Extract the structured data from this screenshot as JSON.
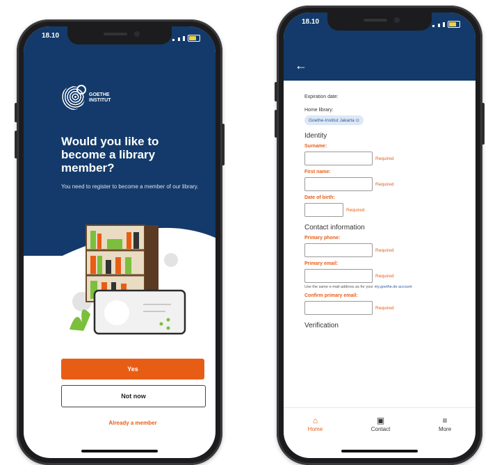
{
  "phone_left": {
    "time": "18.10",
    "logo_line1": "GOETHE",
    "logo_line2": "INSTITUT",
    "title": "Would you like to become a library member?",
    "subtitle": "You need to register to become a member of our library.",
    "yes_label": "Yes",
    "no_label": "Not now",
    "member_link": "Already a member"
  },
  "phone_right": {
    "time": "18.10",
    "form": {
      "expiration_label": "Expiration date:",
      "home_library_label": "Home library:",
      "home_library_value": "Goethe-Institut Jakarta ⊙",
      "identity_heading": "Identity",
      "surname_label": "Surname:",
      "first_name_label": "First name:",
      "dob_label": "Date of birth:",
      "required_text": "Required",
      "contact_heading": "Contact information",
      "primary_phone_label": "Primary phone:",
      "primary_email_label": "Primary email:",
      "email_hint": "Use the same e-mail address as for your",
      "email_hint_link": "my.goethe.de account",
      "confirm_email_label": "Confirm primary email:",
      "verification_heading": "Verification"
    },
    "nav": [
      {
        "label": "Home",
        "icon": "home-icon",
        "active": true
      },
      {
        "label": "Contact",
        "icon": "contact-icon",
        "active": false
      },
      {
        "label": "More",
        "icon": "menu-icon",
        "active": false
      }
    ]
  },
  "colors": {
    "navy": "#133a6a",
    "orange": "#e85d16"
  }
}
